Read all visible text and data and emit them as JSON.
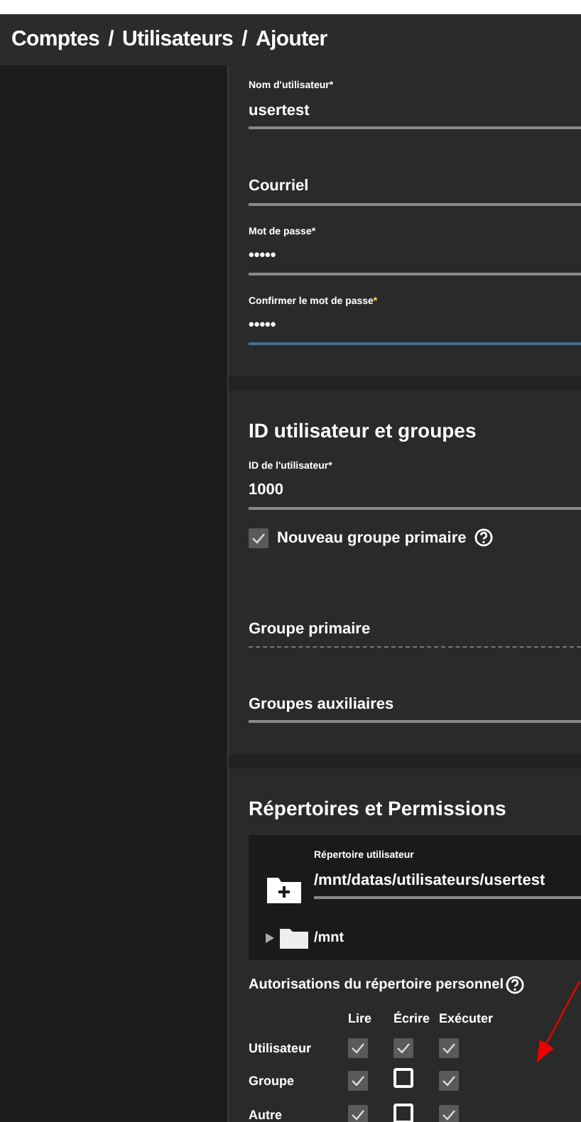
{
  "breadcrumb": {
    "items": [
      "Comptes",
      "Utilisateurs",
      "Ajouter"
    ],
    "separator": "/"
  },
  "sections": [
    {
      "fields": [
        {
          "kind": "text",
          "label": "Nom d'utilisateur",
          "marker": "*",
          "value": "usertest",
          "focused": false,
          "disabled": false
        },
        {
          "kind": "text",
          "placeholder": "Courriel",
          "focused": false,
          "disabled": false
        },
        {
          "kind": "text",
          "label": "Mot de passe",
          "marker": "*",
          "value": "•••••",
          "focused": false,
          "disabled": false
        },
        {
          "kind": "text",
          "label": "Confirmer le mot de passe",
          "marker": "*",
          "value": "•••••",
          "focused": true,
          "disabled": false
        }
      ]
    },
    {
      "title": "ID utilisateur et groupes",
      "fields": [
        {
          "kind": "text",
          "label": "ID de l'utilisateur",
          "marker": "*",
          "value": "1000",
          "focused": false,
          "disabled": false
        },
        {
          "kind": "checkbox",
          "label": "Nouveau groupe primaire",
          "checked": true,
          "help": true
        },
        {
          "kind": "text",
          "placeholder": "Groupe primaire",
          "focused": false,
          "disabled": true
        },
        {
          "kind": "text",
          "placeholder": "Groupes auxiliaires",
          "focused": false,
          "disabled": false
        }
      ]
    },
    {
      "title": "Répertoires et Permissions",
      "directory": {
        "label": "Répertoire utilisateur",
        "value": "/mnt/datas/utilisateurs/usertest",
        "tree": [
          {
            "name": "/mnt",
            "expanded": false
          }
        ]
      },
      "permissions": {
        "title": "Autorisations du répertoire personnel",
        "columns": [
          "Lire",
          "Écrire",
          "Exécuter"
        ],
        "rows": [
          {
            "name": "Utilisateur",
            "checks": [
              true,
              true,
              true
            ]
          },
          {
            "name": "Groupe",
            "checks": [
              true,
              false,
              true
            ]
          },
          {
            "name": "Autre",
            "checks": [
              true,
              false,
              true
            ]
          }
        ]
      }
    }
  ]
}
